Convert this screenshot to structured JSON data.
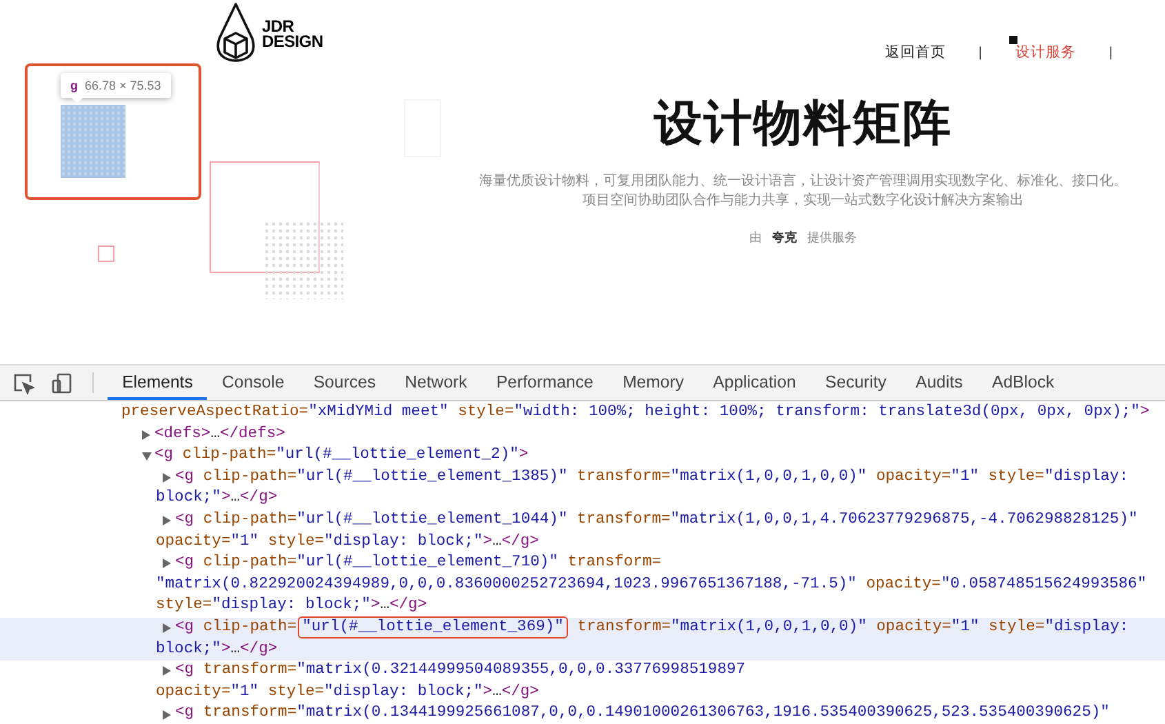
{
  "page": {
    "logo": {
      "line1": "JDR",
      "line2": "DESIGN"
    },
    "nav": [
      {
        "label": "返回首页",
        "separator": "|",
        "selected": false
      },
      {
        "label": "设计服务",
        "separator": "|",
        "selected": true
      }
    ],
    "inspect_tooltip": {
      "tag": "g",
      "size": "66.78 × 75.53"
    },
    "hero": {
      "title": "设计物料矩阵",
      "description": [
        "海量优质设计物料，可复用团队能力、统一设计语言，让设计资产管理调用实现数字化、标准化、接口化。",
        "项目空间协助团队合作与能力共享，实现一站式数字化设计解决方案输出"
      ],
      "credit": "由 **夸克** 提供服务"
    }
  },
  "devtools": {
    "tabs": [
      {
        "label": "Elements",
        "selected": true
      },
      {
        "label": "Console",
        "selected": false
      },
      {
        "label": "Sources",
        "selected": false
      },
      {
        "label": "Network",
        "selected": false
      },
      {
        "label": "Performance",
        "selected": false
      },
      {
        "label": "Memory",
        "selected": false
      },
      {
        "label": "Application",
        "selected": false
      },
      {
        "label": "Security",
        "selected": false
      },
      {
        "label": "Audits",
        "selected": false
      },
      {
        "label": "AdBlock",
        "selected": false
      }
    ],
    "elements": [
      {
        "kind": "continuation",
        "selected": false,
        "lines": [
          [
            {
              "kind": "attr",
              "t": "preserveAspectRatio="
            },
            {
              "kind": "value",
              "t": "\"xMidYMid meet\""
            },
            {
              "kind": "attr",
              "t": "style="
            },
            {
              "kind": "value",
              "t": "\"width: 100%; height: 100%; transform: translate3d(0px, 0px, 0px);\""
            },
            {
              "kind": "tag",
              "t": ">"
            }
          ]
        ]
      },
      {
        "kind": "element",
        "expanded": false,
        "selected": false,
        "lines": [
          [
            {
              "kind": "tag",
              "t": "<defs>"
            },
            {
              "kind": "text",
              "t": "…"
            },
            {
              "kind": "tag",
              "t": "</defs>"
            }
          ]
        ]
      },
      {
        "kind": "element",
        "expanded": true,
        "selected": false,
        "lines": [
          [
            {
              "kind": "tag",
              "t": "<g"
            },
            {
              "kind": "attr",
              "t": "clip-path="
            },
            {
              "kind": "value",
              "t": "\"url(#__lottie_element_2)\""
            },
            {
              "kind": "tag",
              "t": ">"
            }
          ]
        ],
        "children": [
          {
            "kind": "element",
            "expanded": false,
            "selected": false,
            "lines": [
              [
                {
                  "kind": "tag",
                  "t": "<g"
                },
                {
                  "kind": "attr",
                  "t": "clip-path="
                },
                {
                  "kind": "value",
                  "t": "\"url(#__lottie_element_1385)\""
                },
                {
                  "kind": "attr",
                  "t": "transform="
                },
                {
                  "kind": "value",
                  "t": "\"matrix(1,0,0,1,0,0)\""
                },
                {
                  "kind": "attr",
                  "t": "opacity="
                },
                {
                  "kind": "value",
                  "t": "\"1\""
                },
                {
                  "kind": "attr",
                  "t": "style="
                },
                {
                  "kind": "value",
                  "t": "\"display:"
                }
              ],
              [
                {
                  "kind": "value",
                  "t": "block;\""
                },
                {
                  "kind": "tag",
                  "t": ">"
                },
                {
                  "kind": "text",
                  "t": "…"
                },
                {
                  "kind": "tag",
                  "t": "</g>"
                }
              ]
            ]
          },
          {
            "kind": "element",
            "expanded": false,
            "selected": false,
            "lines": [
              [
                {
                  "kind": "tag",
                  "t": "<g"
                },
                {
                  "kind": "attr",
                  "t": "clip-path="
                },
                {
                  "kind": "value",
                  "t": "\"url(#__lottie_element_1044)\""
                },
                {
                  "kind": "attr",
                  "t": "transform="
                },
                {
                  "kind": "value",
                  "t": "\"matrix(1,0,0,1,4.70623779296875,-4.706298828125)\""
                }
              ],
              [
                {
                  "kind": "attr",
                  "t": "opacity="
                },
                {
                  "kind": "value",
                  "t": "\"1\""
                },
                {
                  "kind": "attr",
                  "t": "style="
                },
                {
                  "kind": "value",
                  "t": "\"display: block;\""
                },
                {
                  "kind": "tag",
                  "t": ">"
                },
                {
                  "kind": "text",
                  "t": "…"
                },
                {
                  "kind": "tag",
                  "t": "</g>"
                }
              ]
            ]
          },
          {
            "kind": "element",
            "expanded": false,
            "selected": false,
            "lines": [
              [
                {
                  "kind": "tag",
                  "t": "<g"
                },
                {
                  "kind": "attr",
                  "t": "clip-path="
                },
                {
                  "kind": "value",
                  "t": "\"url(#__lottie_element_710)\""
                },
                {
                  "kind": "attr",
                  "t": "transform="
                }
              ],
              [
                {
                  "kind": "value",
                  "t": "\"matrix(0.822920024394989,0,0,0.8360000252723694,1023.9967651367188,-71.5)\""
                },
                {
                  "kind": "attr",
                  "t": "opacity="
                },
                {
                  "kind": "value",
                  "t": "\"0.058748515624993586\""
                }
              ],
              [
                {
                  "kind": "attr",
                  "t": "style="
                },
                {
                  "kind": "value",
                  "t": "\"display: block;\""
                },
                {
                  "kind": "tag",
                  "t": ">"
                },
                {
                  "kind": "text",
                  "t": "…"
                },
                {
                  "kind": "tag",
                  "t": "</g>"
                }
              ]
            ]
          },
          {
            "kind": "element",
            "expanded": false,
            "selected": true,
            "lines": [
              [
                {
                  "kind": "tag",
                  "t": "<g"
                },
                {
                  "kind": "attr",
                  "t": "clip-path="
                },
                {
                  "kind": "value",
                  "t": "\"url(#__lottie_element_369)\"",
                  "boxed": true
                },
                {
                  "kind": "attr",
                  "t": "transform="
                },
                {
                  "kind": "value",
                  "t": "\"matrix(1,0,0,1,0,0)\""
                },
                {
                  "kind": "attr",
                  "t": "opacity="
                },
                {
                  "kind": "value",
                  "t": "\"1\""
                },
                {
                  "kind": "attr",
                  "t": "style="
                },
                {
                  "kind": "value",
                  "t": "\"display:"
                }
              ],
              [
                {
                  "kind": "value",
                  "t": "block;\""
                },
                {
                  "kind": "tag",
                  "t": ">"
                },
                {
                  "kind": "text",
                  "t": "…"
                },
                {
                  "kind": "tag",
                  "t": "</g>"
                }
              ]
            ]
          },
          {
            "kind": "element",
            "expanded": false,
            "selected": false,
            "lines": [
              [
                {
                  "kind": "tag",
                  "t": "<g"
                },
                {
                  "kind": "attr",
                  "t": "transform="
                },
                {
                  "kind": "value",
                  "t": "\"matrix(0.32144999504089355,0,0,0.33776998519897"
                }
              ],
              [
                {
                  "kind": "attr",
                  "t": "opacity="
                },
                {
                  "kind": "value",
                  "t": "\"1\""
                },
                {
                  "kind": "attr",
                  "t": "style="
                },
                {
                  "kind": "value",
                  "t": "\"display: block;\""
                },
                {
                  "kind": "tag",
                  "t": ">"
                },
                {
                  "kind": "text",
                  "t": "…"
                },
                {
                  "kind": "tag",
                  "t": "</g>"
                }
              ]
            ]
          },
          {
            "kind": "element",
            "expanded": false,
            "selected": false,
            "lines": [
              [
                {
                  "kind": "tag",
                  "t": "<g"
                },
                {
                  "kind": "attr",
                  "t": "transform="
                },
                {
                  "kind": "value",
                  "t": "\"matrix(0.1344199925661087,0,0,0.14901000261306763,1916.535400390625,523.535400390625)\""
                }
              ]
            ]
          }
        ]
      }
    ]
  }
}
